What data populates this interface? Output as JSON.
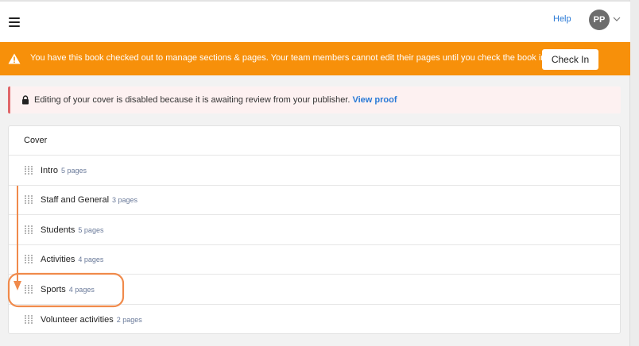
{
  "header": {
    "help_label": "Help",
    "avatar_initials": "PP",
    "icons": [
      "hamburger-menu-icon",
      "chevron-down-icon"
    ]
  },
  "banner": {
    "message": "You have this book checked out to manage sections & pages. Your team members cannot edit their pages until you check the book in.",
    "button_label": "Check In",
    "color": "#f7900a",
    "icon": "warning-icon"
  },
  "notice": {
    "message": "Editing of your cover is disabled because it is awaiting review from your publisher.",
    "link_label": "View proof",
    "icon": "lock-icon"
  },
  "sections": {
    "cover_label": "Cover",
    "items": [
      {
        "name": "Intro",
        "count": "5 pages"
      },
      {
        "name": "Staff and General",
        "count": "3 pages"
      },
      {
        "name": "Students",
        "count": "5 pages"
      },
      {
        "name": "Activities",
        "count": "4 pages"
      },
      {
        "name": "Sports",
        "count": "4 pages"
      },
      {
        "name": "Volunteer activities",
        "count": "2 pages"
      }
    ]
  },
  "annotation": {
    "highlight_color": "#f08a4b",
    "highlighted_item": "Sports"
  }
}
